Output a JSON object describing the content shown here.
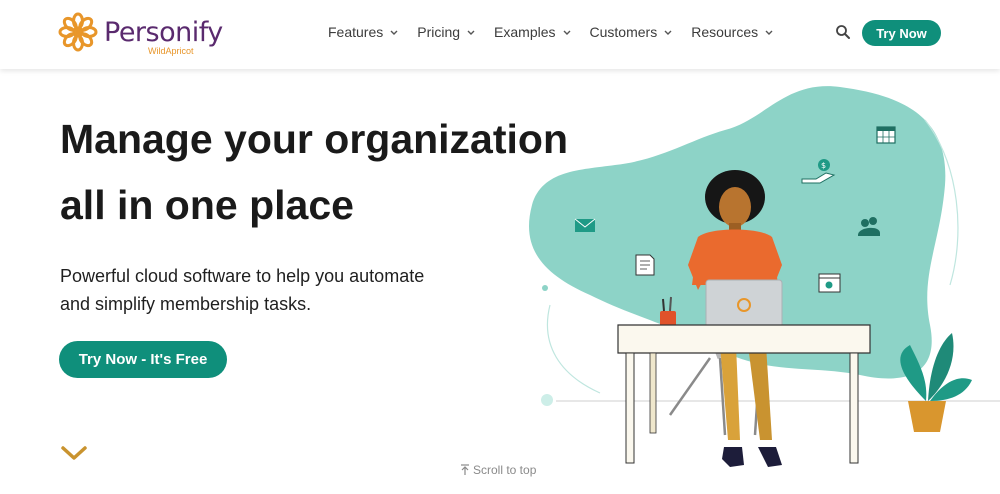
{
  "brand": {
    "name": "Personify",
    "sub": "WildApricot"
  },
  "nav": {
    "items": [
      {
        "label": "Features"
      },
      {
        "label": "Pricing"
      },
      {
        "label": "Examples"
      },
      {
        "label": "Customers"
      },
      {
        "label": "Resources"
      }
    ],
    "cta_label": "Try Now"
  },
  "hero": {
    "title_line1": "Manage your organization",
    "title_line2": "all in one place",
    "sub_line1": "Powerful cloud software to help you automate",
    "sub_line2": "and simplify membership tasks.",
    "cta_label": "Try Now - It's Free"
  },
  "footer": {
    "scroll_top_label": "Scroll to top"
  },
  "icons": {
    "search": "search-icon",
    "chevron": "chevron-down-icon",
    "scroll_down": "chevron-down-icon",
    "scroll_top": "arrow-up-icon"
  },
  "colors": {
    "brand_purple": "#5a2a6e",
    "brand_orange": "#e8962a",
    "accent_teal": "#0f8f7b",
    "blob_mint": "#8dd3c7"
  }
}
